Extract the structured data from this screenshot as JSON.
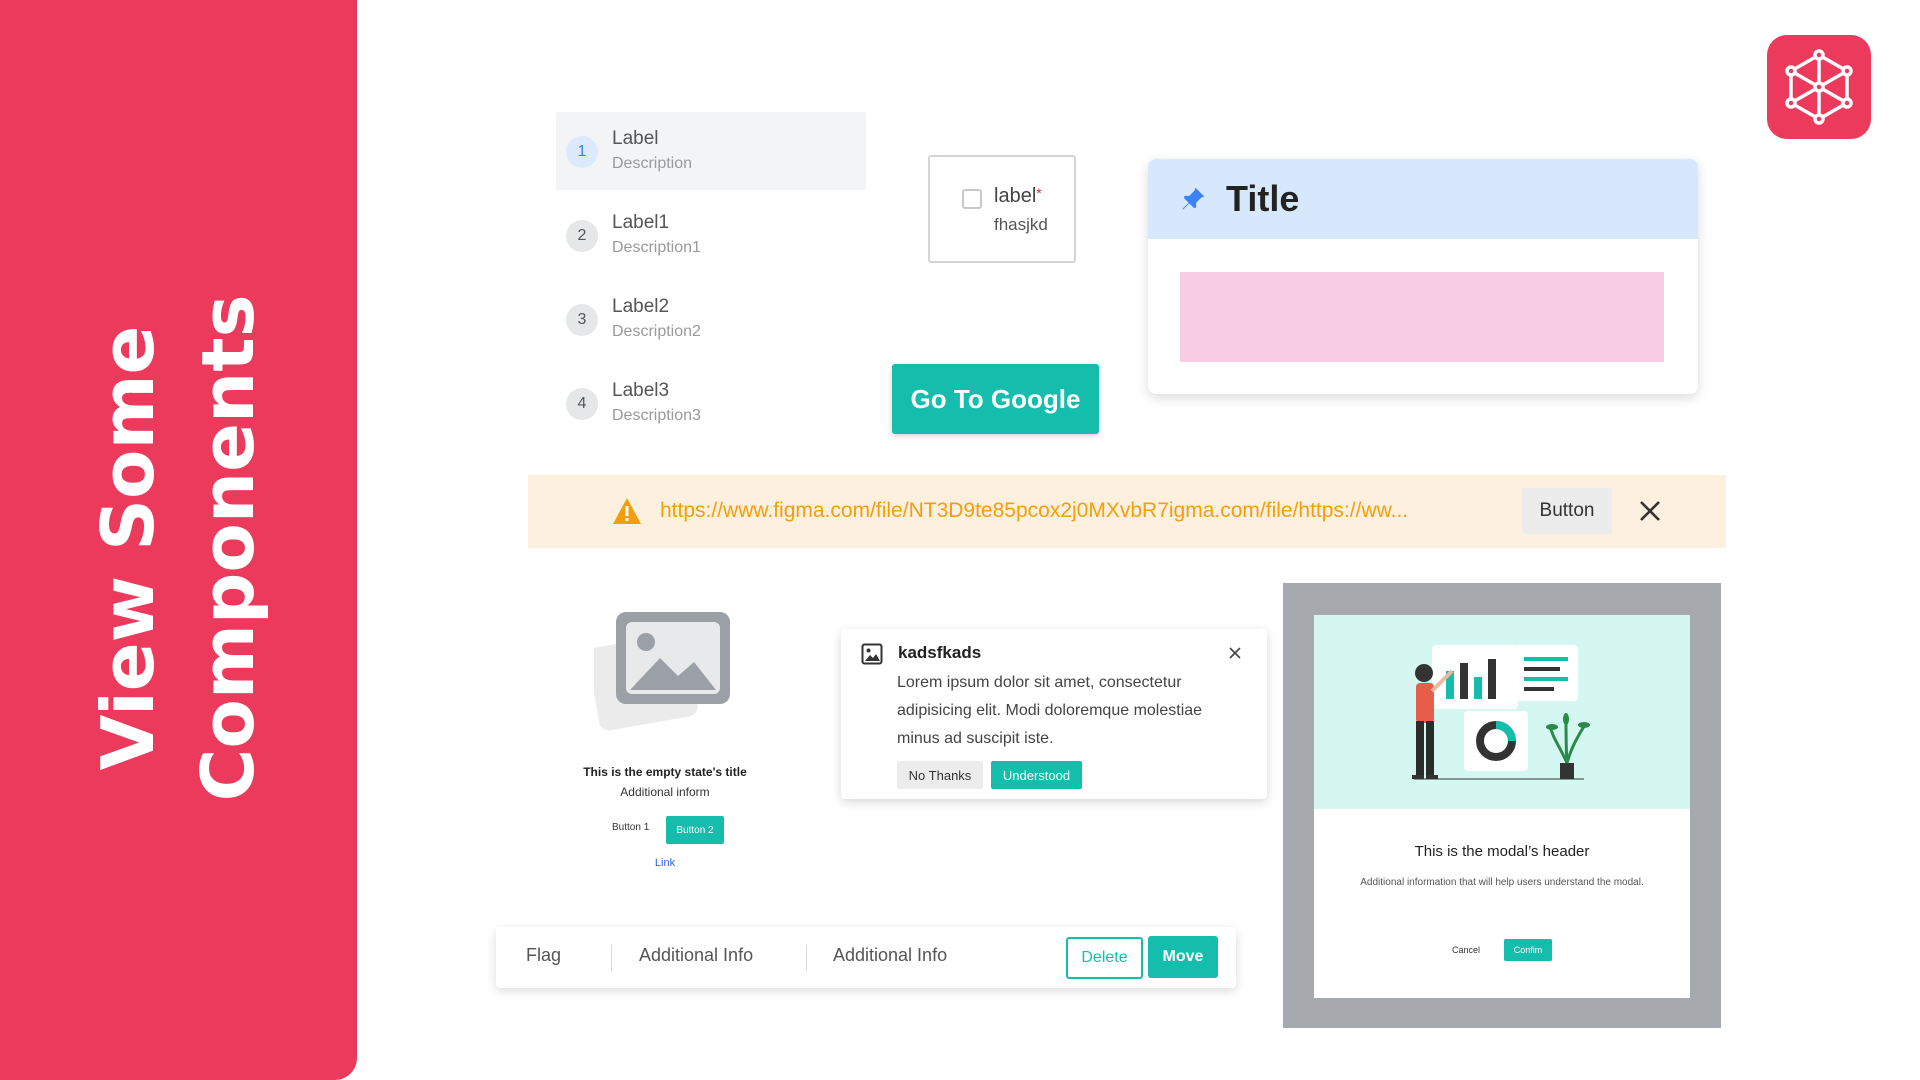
{
  "side_panel": {
    "line1": "View Some",
    "line2": "Components"
  },
  "steps": [
    {
      "number": "1",
      "label": "Label",
      "description": "Description"
    },
    {
      "number": "2",
      "label": "Label1",
      "description": "Description1"
    },
    {
      "number": "3",
      "label": "Label2",
      "description": "Description2"
    },
    {
      "number": "4",
      "label": "Label3",
      "description": "Description3"
    }
  ],
  "checkbox_card": {
    "label": "label",
    "required_mark": "*",
    "sublabel": "fhasjkd"
  },
  "google_button": {
    "label": "Go To Google"
  },
  "title_card": {
    "title": "Title"
  },
  "banner": {
    "url_text": "https://www.figma.com/file/NT3D9te85pcox2j0MXvbR7igma.com/file/https://ww...",
    "button_label": "Button"
  },
  "empty_state": {
    "title": "This is the empty state's title",
    "subtitle": "Additional inform",
    "button1": "Button 1",
    "button2": "Button 2",
    "link": "Link"
  },
  "notification": {
    "title": "kadsfkads",
    "body": "Lorem ipsum dolor sit amet, consectetur adipisicing elit. Modi doloremque molestiae minus ad suscipit iste.",
    "secondary_button": "No Thanks",
    "primary_button": "Understood"
  },
  "action_bar": {
    "items": [
      "Flag",
      "Additional Info",
      "Additional Info"
    ],
    "delete_label": "Delete",
    "move_label": "Move"
  },
  "modal": {
    "header": "This is the modal’s header",
    "description": "Additional information that will help users understand the modal.",
    "cancel_label": "Cancel",
    "confirm_label": "Confim"
  },
  "colors": {
    "brand_red": "#EC3A5C",
    "teal": "#14BDAC",
    "warning": "#F59E0B",
    "title_header_blue": "#D7E8FD",
    "pink_block": "#F6CDE5"
  },
  "icons": [
    "logo-network-icon",
    "pin-icon",
    "warning-icon",
    "close-icon",
    "image-icon",
    "empty-image-icon"
  ]
}
